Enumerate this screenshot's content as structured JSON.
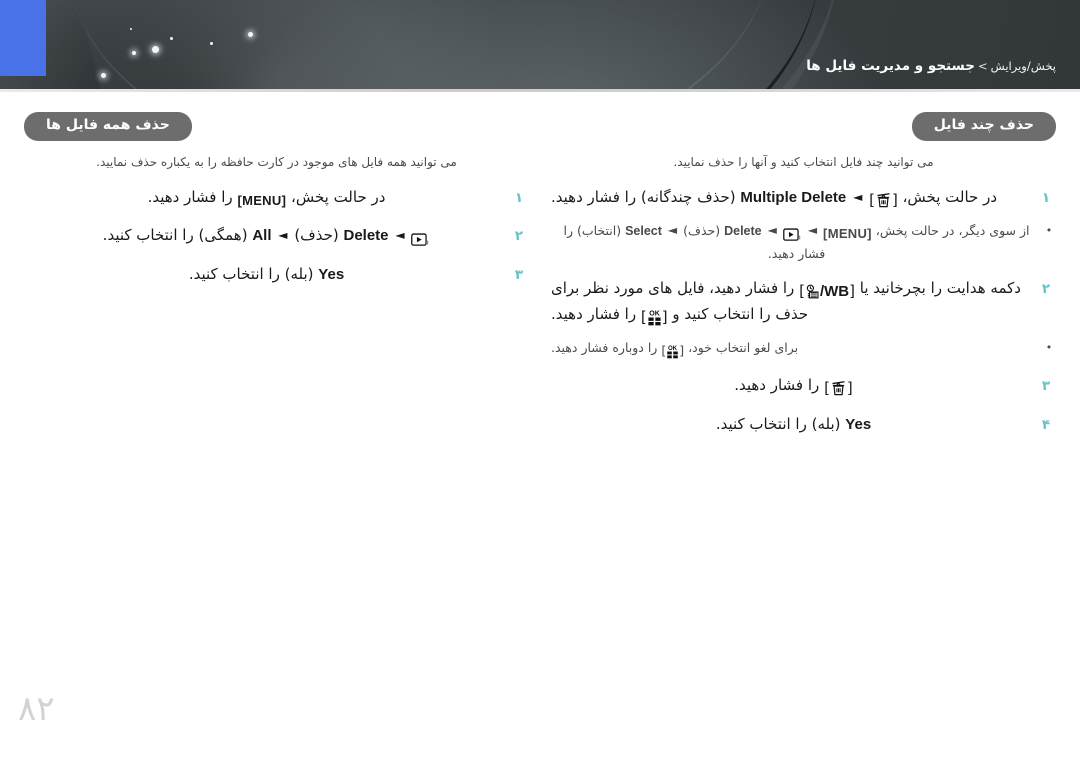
{
  "header": {
    "breadcrumb_parent": "پخش/ويرايش",
    "breadcrumb_sep": ">",
    "breadcrumb_current": "جستجو و مديريت فايل ها"
  },
  "right_section": {
    "title": "حذف چند فايل",
    "intro": "می توانید چند فایل انتخاب کنید و آنها را حذف نمایید.",
    "steps": [
      {
        "num": "۱",
        "pre": "در حالت پخش،",
        "key": "trash-icon",
        "arrow": "◄",
        "latin": "Multiple Delete",
        "paren": "(حذف چندگانه)",
        "post": "را فشار دهید."
      },
      {
        "num": "۲",
        "pre": "دکمه هدایت را بچرخانید یا",
        "key": "drive-wb-icon",
        "latin": "/WB",
        "mid": "را فشار دهید، فایل های مورد نظر برای حذف را انتخاب کنید و",
        "key2": "ok-grid-icon",
        "post": "را فشار دهید."
      },
      {
        "num": "۳",
        "pre": "",
        "key": "trash-icon",
        "post": "را فشار دهید."
      },
      {
        "num": "۴",
        "latin": "Yes",
        "paren": "(بله)",
        "post": "را انتخاب کنید."
      }
    ],
    "bullet_alt": {
      "dot": "•",
      "pre": "از سوی دیگر، در حالت پخش،",
      "key_menu": "MENU",
      "arrow": "◄",
      "key_play": "playback-icon",
      "latin_delete": "Delete",
      "paren_delete": "(حذف)",
      "latin_select": "Select",
      "paren_select": "(انتخاب)",
      "post": "را فشار دهید."
    },
    "bullet_cancel": {
      "dot": "•",
      "pre": "برای لغو انتخاب خود،",
      "key": "ok-grid-icon",
      "post": "را دوباره فشار دهید."
    }
  },
  "left_section": {
    "title": "حذف همه فايل ها",
    "intro": "می توانید همه فایل های موجود در کارت حافظه را به یکباره حذف نمایید.",
    "steps": [
      {
        "num": "۱",
        "pre": "در حالت پخش،",
        "key_menu": "MENU",
        "post": "را فشار دهید."
      },
      {
        "num": "۲",
        "key_play": "playback-icon",
        "arrow": "◄",
        "latin_delete": "Delete",
        "paren_delete": "(حذف)",
        "latin_all": "All",
        "paren_all": "(همگی)",
        "post": "را انتخاب کنید."
      },
      {
        "num": "۳",
        "latin": "Yes",
        "paren": "(بله)",
        "post": "را انتخاب کنید."
      }
    ]
  },
  "footer": {
    "page_number": "۸۲"
  },
  "colors": {
    "accent_blue": "#4a72e8",
    "banner": "#3d4346",
    "pill": "#6d6d6d",
    "step_number": "#66c4c8",
    "page_number": "#d2d2d4"
  }
}
